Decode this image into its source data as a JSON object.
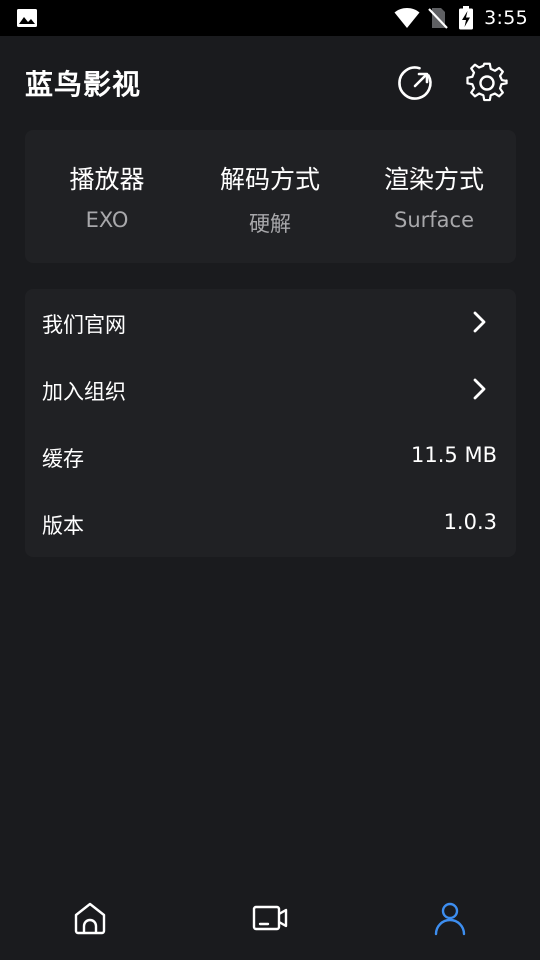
{
  "status_bar": {
    "time": "3:55"
  },
  "header": {
    "title": "蓝鸟影视"
  },
  "player_settings": [
    {
      "label": "播放器",
      "value": "EXO"
    },
    {
      "label": "解码方式",
      "value": "硬解"
    },
    {
      "label": "渲染方式",
      "value": "Surface"
    }
  ],
  "menu": {
    "official_site": "我们官网",
    "join_group": "加入组织",
    "cache_label": "缓存",
    "cache_value": "11.5 MB",
    "version_label": "版本",
    "version_value": "1.0.3"
  },
  "bottom_nav": {
    "items": [
      "home-icon",
      "video-icon",
      "user-icon"
    ],
    "active": "user-icon"
  },
  "colors": {
    "background": "#1a1b1e",
    "card": "#202124",
    "accent": "#3d8ef0",
    "muted_text": "#a8a8ab"
  }
}
